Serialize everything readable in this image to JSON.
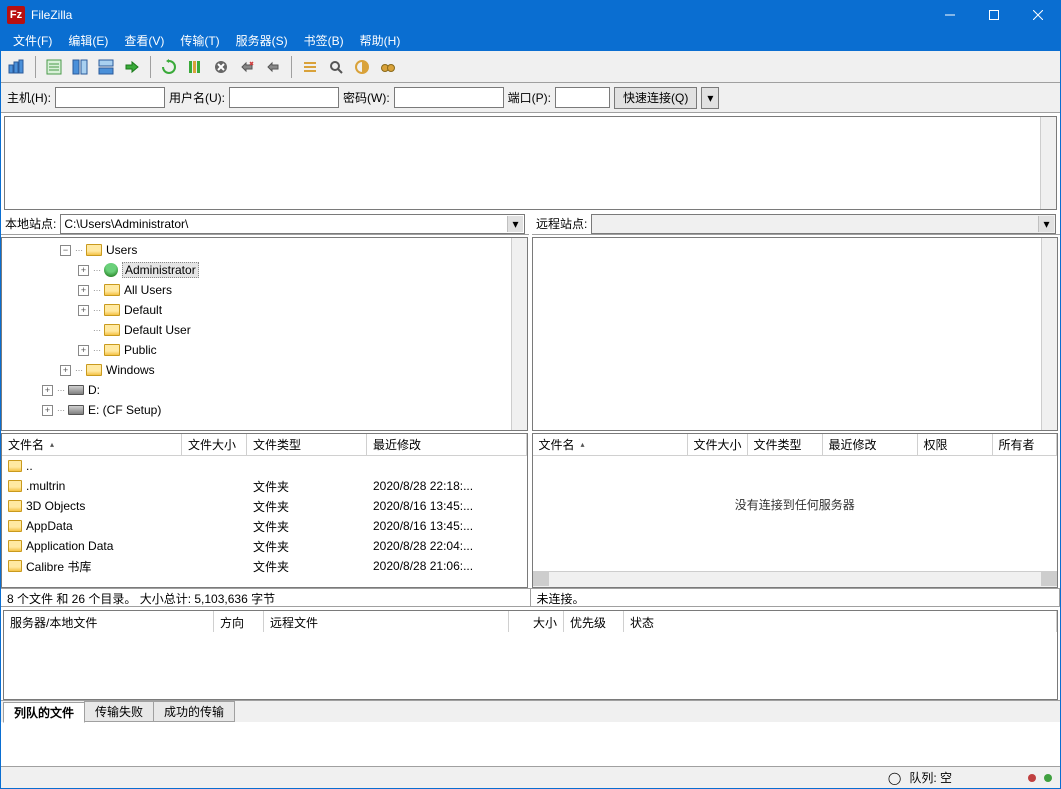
{
  "app": {
    "title": "FileZilla"
  },
  "menu": [
    "文件(F)",
    "编辑(E)",
    "查看(V)",
    "传输(T)",
    "服务器(S)",
    "书签(B)",
    "帮助(H)"
  ],
  "quickconnect": {
    "host_label": "主机(H):",
    "user_label": "用户名(U):",
    "pass_label": "密码(W):",
    "port_label": "端口(P):",
    "connect_label": "快速连接(Q)"
  },
  "local": {
    "site_label": "本地站点:",
    "site_value": "C:\\Users\\Administrator\\",
    "tree": [
      {
        "depth": 3,
        "exp": "-",
        "icon": "folder",
        "label": "Users"
      },
      {
        "depth": 4,
        "exp": "+",
        "icon": "user",
        "label": "Administrator",
        "selected": true
      },
      {
        "depth": 4,
        "exp": "+",
        "icon": "folder",
        "label": "All Users"
      },
      {
        "depth": 4,
        "exp": "+",
        "icon": "folder",
        "label": "Default"
      },
      {
        "depth": 4,
        "exp": " ",
        "icon": "folder",
        "label": "Default User"
      },
      {
        "depth": 4,
        "exp": "+",
        "icon": "folder",
        "label": "Public"
      },
      {
        "depth": 3,
        "exp": "+",
        "icon": "folder",
        "label": "Windows"
      },
      {
        "depth": 2,
        "exp": "+",
        "icon": "drive",
        "label": "D:"
      },
      {
        "depth": 2,
        "exp": "+",
        "icon": "drive",
        "label": "E: (CF Setup)"
      }
    ],
    "columns": {
      "name": "文件名",
      "size": "文件大小",
      "type": "文件类型",
      "modified": "最近修改"
    },
    "files": [
      {
        "name": "..",
        "size": "",
        "type": "",
        "modified": ""
      },
      {
        "name": ".multrin",
        "size": "",
        "type": "文件夹",
        "modified": "2020/8/28 22:18:..."
      },
      {
        "name": "3D Objects",
        "size": "",
        "type": "文件夹",
        "modified": "2020/8/16 13:45:..."
      },
      {
        "name": "AppData",
        "size": "",
        "type": "文件夹",
        "modified": "2020/8/16 13:45:..."
      },
      {
        "name": "Application Data",
        "size": "",
        "type": "文件夹",
        "modified": "2020/8/28 22:04:..."
      },
      {
        "name": "Calibre 书库",
        "size": "",
        "type": "文件夹",
        "modified": "2020/8/28 21:06:..."
      }
    ],
    "status": "8 个文件 和 26 个目录。 大小总计: 5,103,636 字节"
  },
  "remote": {
    "site_label": "远程站点:",
    "columns": {
      "name": "文件名",
      "size": "文件大小",
      "type": "文件类型",
      "modified": "最近修改",
      "perm": "权限",
      "owner": "所有者"
    },
    "no_connect": "没有连接到任何服务器",
    "status": "未连接。"
  },
  "queue": {
    "columns": {
      "server": "服务器/本地文件",
      "dir": "方向",
      "remote": "远程文件",
      "size": "大小",
      "prio": "优先级",
      "status": "状态"
    },
    "tabs": [
      "列队的文件",
      "传输失败",
      "成功的传输"
    ],
    "status": "队列: 空"
  }
}
